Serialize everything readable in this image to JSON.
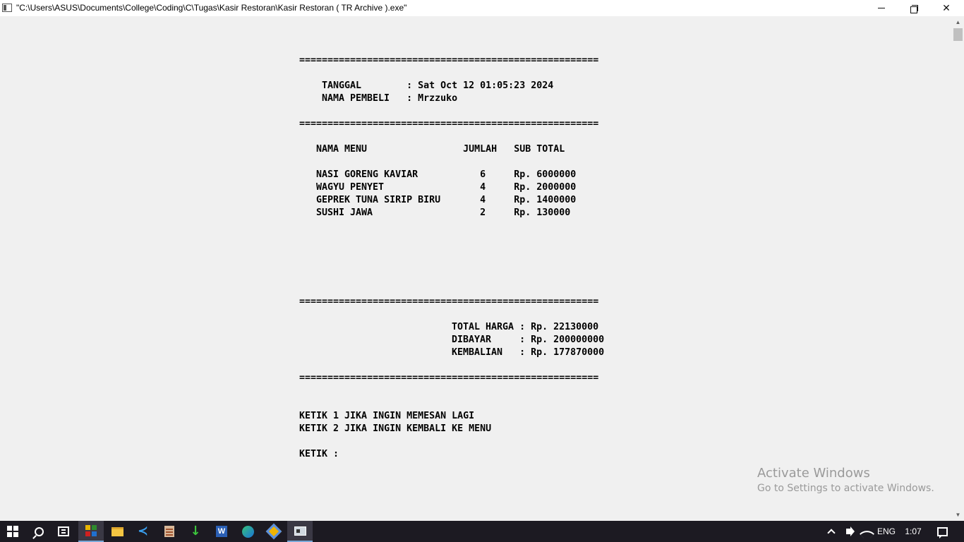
{
  "window": {
    "title": "\"C:\\Users\\ASUS\\Documents\\College\\Coding\\C\\Tugas\\Kasir Restoran\\Kasir Restoran ( TR Archive ).exe\""
  },
  "console": {
    "separator": "=====================================================",
    "tanggal_line": "TANGGAL        : Sat Oct 12 01:05:23 2024",
    "nama_line": "NAMA PEMBELI   : Mrzzuko",
    "header_line": "NAMA MENU                 JUMLAH   SUB TOTAL",
    "items": [
      "NASI GORENG KAVIAR           6     Rp. 6000000",
      "WAGYU PENYET                 4     Rp. 2000000",
      "GEPREK TUNA SIRIP BIRU       4     Rp. 1400000",
      "SUSHI JAWA                   2     Rp. 130000"
    ],
    "total_harga": "TOTAL HARGA : Rp. 22130000",
    "dibayar": "DIBAYAR     : Rp. 200000000",
    "kembalian": "KEMBALIAN   : Rp. 177870000",
    "option1": "KETIK 1 JIKA INGIN MEMESAN LAGI",
    "option2": "KETIK 2 JIKA INGIN KEMBALI KE MENU",
    "prompt": "KETIK :"
  },
  "watermark": {
    "line1": "Activate Windows",
    "line2": "Go to Settings to activate Windows."
  },
  "taskbar": {
    "language": "ENG",
    "time": "1:07",
    "apps": [
      "start",
      "search",
      "task-view",
      "app-grid",
      "file-explorer",
      "vscode",
      "video-editor",
      "downloader",
      "word",
      "edge",
      "settings-app",
      "console"
    ]
  }
}
